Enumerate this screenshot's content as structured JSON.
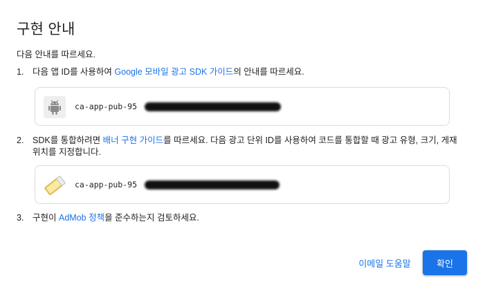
{
  "dialog": {
    "title": "구현 안내",
    "intro": "다음 안내를 따르세요."
  },
  "steps": [
    {
      "number": "1.",
      "pre": "다음 앱 ID를 사용하여 ",
      "link": "Google 모바일 광고 SDK 가이드",
      "post": "의 안내를 따르세요."
    },
    {
      "number": "2.",
      "pre": "SDK를 통합하려면 ",
      "link": "배너 구현 가이드",
      "post": "를 따르세요. 다음 광고 단위 ID를 사용하여 코드를 통합할 때 광고 유형, 크기, 게재위치를 지정합니다."
    },
    {
      "number": "3.",
      "pre": "구현이 ",
      "link": "AdMob 정책",
      "post": "을 준수하는지 검토하세요."
    }
  ],
  "app_id": {
    "icon": "android-icon",
    "prefix": "ca-app-pub-95"
  },
  "ad_unit_id": {
    "icon": "banner-ad-icon",
    "prefix": "ca-app-pub-95"
  },
  "buttons": {
    "help": "이메일 도움말",
    "confirm": "확인"
  },
  "colors": {
    "link": "#1a73e8",
    "primary": "#1a73e8",
    "border": "#dadce0"
  }
}
